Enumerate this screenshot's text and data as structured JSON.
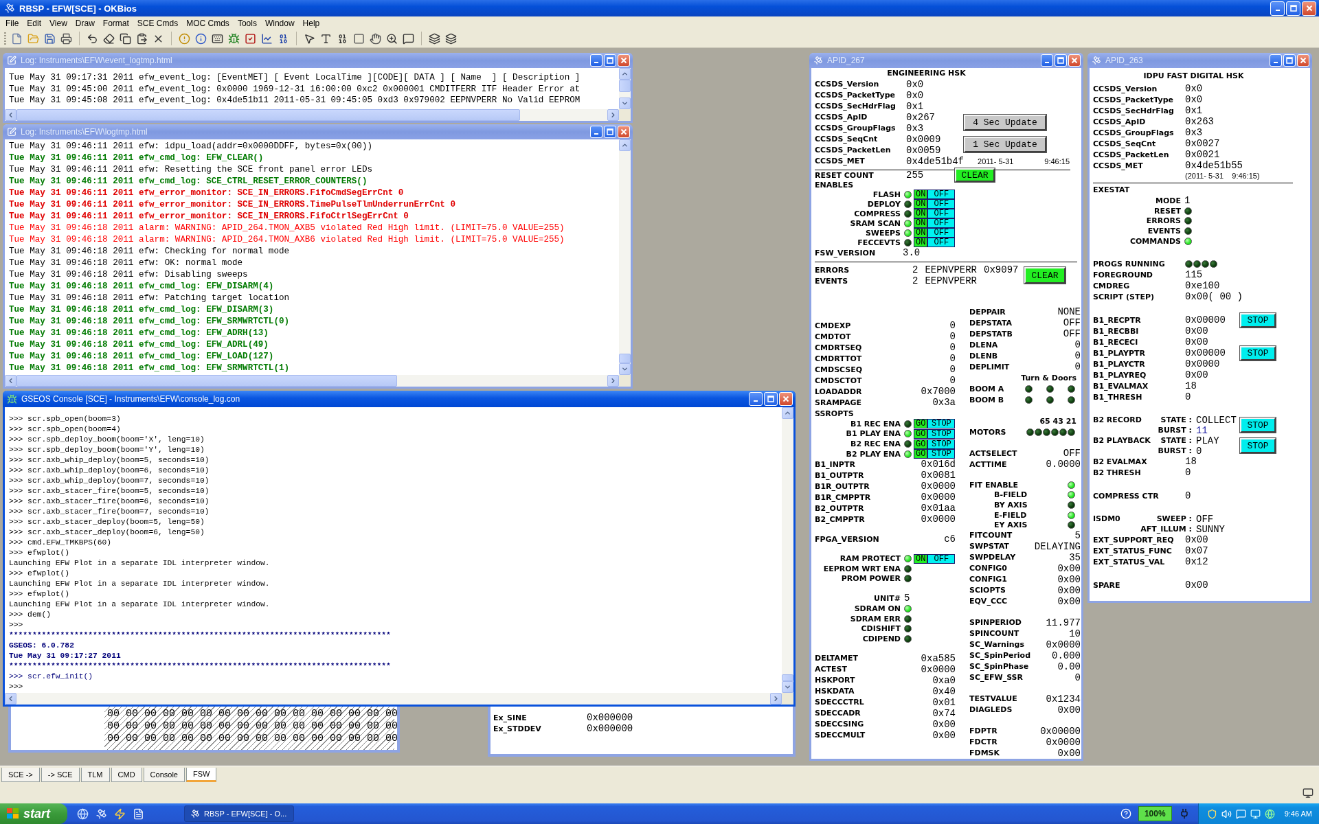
{
  "app": {
    "title": "RBSP - EFW[SCE] - OKBios"
  },
  "menu": [
    "File",
    "Edit",
    "View",
    "Draw",
    "Format",
    "SCE Cmds",
    "MOC Cmds",
    "Tools",
    "Window",
    "Help"
  ],
  "event_log": {
    "title": "Log: Instruments\\EFW\\event_logtmp.html",
    "lines": [
      "Tue May 31 09:17:31 2011 efw_event_log: [EventMET] [ Event LocalTime ][CODE][ DATA ] [ Name  ] [ Description ]",
      "Tue May 31 09:45:00 2011 efw_event_log: 0x0000 1969-12-31 16:00:00 0xc2 0x000001 CMDITFERR ITF Header Error at",
      "Tue May 31 09:45:08 2011 efw_event_log: 0x4de51b11 2011-05-31 09:45:05 0xd3 0x979002 EEPNVPERR No Valid EEPROM"
    ]
  },
  "log": {
    "title": "Log: Instruments\\EFW\\logtmp.html",
    "lines": [
      {
        "kind": "info",
        "text": "Tue May 31 09:46:11 2011 efw: idpu_load(addr=0x0000DDFF, bytes=0x(00))"
      },
      {
        "kind": "cmd",
        "text": "Tue May 31 09:46:11 2011 efw_cmd_log: EFW_CLEAR()"
      },
      {
        "kind": "info",
        "text": "Tue May 31 09:46:11 2011 efw: Resetting the SCE front panel error LEDs"
      },
      {
        "kind": "cmd",
        "text": "Tue May 31 09:46:11 2011 efw_cmd_log: SCE_CTRL_RESET_ERROR_COUNTERS()"
      },
      {
        "kind": "error",
        "text": "Tue May 31 09:46:11 2011 efw_error_monitor: SCE_IN_ERRORS.FifoCmdSegErrCnt 0"
      },
      {
        "kind": "error",
        "text": "Tue May 31 09:46:11 2011 efw_error_monitor: SCE_IN_ERRORS.TimePulseTlmUnderrunErrCnt 0"
      },
      {
        "kind": "error",
        "text": "Tue May 31 09:46:11 2011 efw_error_monitor: SCE_IN_ERRORS.FifoCtrlSegErrCnt 0"
      },
      {
        "kind": "alarm",
        "text": "Tue May 31 09:46:18 2011 alarm: WARNING: APID_264.TMON_AXB5 violated Red High limit. (LIMIT=75.0 VALUE=255)"
      },
      {
        "kind": "alarm",
        "text": "Tue May 31 09:46:18 2011 alarm: WARNING: APID_264.TMON_AXB6 violated Red High limit. (LIMIT=75.0 VALUE=255)"
      },
      {
        "kind": "info",
        "text": "Tue May 31 09:46:18 2011 efw: Checking for normal mode"
      },
      {
        "kind": "info",
        "text": "Tue May 31 09:46:18 2011 efw: OK: normal mode"
      },
      {
        "kind": "info",
        "text": "Tue May 31 09:46:18 2011 efw: Disabling sweeps"
      },
      {
        "kind": "cmd",
        "text": "Tue May 31 09:46:18 2011 efw_cmd_log: EFW_DISARM(4)"
      },
      {
        "kind": "info",
        "text": "Tue May 31 09:46:18 2011 efw: Patching target location"
      },
      {
        "kind": "cmd",
        "text": "Tue May 31 09:46:18 2011 efw_cmd_log: EFW_DISARM(3)"
      },
      {
        "kind": "cmd",
        "text": "Tue May 31 09:46:18 2011 efw_cmd_log: EFW_SRMWRTCTL(0)"
      },
      {
        "kind": "cmd",
        "text": "Tue May 31 09:46:18 2011 efw_cmd_log: EFW_ADRH(13)"
      },
      {
        "kind": "cmd",
        "text": "Tue May 31 09:46:18 2011 efw_cmd_log: EFW_ADRL(49)"
      },
      {
        "kind": "cmd",
        "text": "Tue May 31 09:46:18 2011 efw_cmd_log: EFW_LOAD(127)"
      },
      {
        "kind": "cmd",
        "text": "Tue May 31 09:46:18 2011 efw_cmd_log: EFW_SRMWRTCTL(1)"
      }
    ]
  },
  "console": {
    "title": "GSEOS Console  [SCE] - Instruments\\EFW\\console_log.con",
    "lines": [
      {
        "kind": "plain",
        "text": ">>> scr.spb_open(boom=3)"
      },
      {
        "kind": "plain",
        "text": ">>> scr.spb_open(boom=4)"
      },
      {
        "kind": "plain",
        "text": ">>> scr.spb_deploy_boom(boom='X', leng=10)"
      },
      {
        "kind": "plain",
        "text": ">>> scr.spb_deploy_boom(boom='Y', leng=10)"
      },
      {
        "kind": "plain",
        "text": ">>> scr.axb_whip_deploy(boom=5, seconds=10)"
      },
      {
        "kind": "plain",
        "text": ">>> scr.axb_whip_deploy(boom=6, seconds=10)"
      },
      {
        "kind": "plain",
        "text": ">>> scr.axb_whip_deploy(boom=7, seconds=10)"
      },
      {
        "kind": "plain",
        "text": ">>> scr.axb_stacer_fire(boom=5, seconds=10)"
      },
      {
        "kind": "plain",
        "text": ">>> scr.axb_stacer_fire(boom=6, seconds=10)"
      },
      {
        "kind": "plain",
        "text": ">>> scr.axb_stacer_fire(boom=7, seconds=10)"
      },
      {
        "kind": "plain",
        "text": ">>> scr.axb_stacer_deploy(boom=5, leng=50)"
      },
      {
        "kind": "plain",
        "text": ">>> scr.axb_stacer_deploy(boom=6, leng=50)"
      },
      {
        "kind": "plain",
        "text": ">>> cmd.EFW_TMKBPS(60)"
      },
      {
        "kind": "plain",
        "text": ">>> efwplot()"
      },
      {
        "kind": "plain",
        "text": "Launching EFW Plot in a separate IDL interpreter window."
      },
      {
        "kind": "plain",
        "text": ">>> efwplot()"
      },
      {
        "kind": "plain",
        "text": "Launching EFW Plot in a separate IDL interpreter window."
      },
      {
        "kind": "plain",
        "text": ">>> efwplot()"
      },
      {
        "kind": "plain",
        "text": "Launching EFW Plot in a separate IDL interpreter window."
      },
      {
        "kind": "plain",
        "text": ">>> dem()"
      },
      {
        "kind": "plain",
        "text": ">>>"
      },
      {
        "kind": "banner",
        "text": "**********************************************************************************"
      },
      {
        "kind": "banner",
        "text": "GSEOS: 6.0.782"
      },
      {
        "kind": "banner",
        "text": "Tue May 31 09:17:27 2011"
      },
      {
        "kind": "banner",
        "text": "**********************************************************************************"
      },
      {
        "kind": "echo",
        "text": ">>> scr.efw_init()"
      },
      {
        "kind": "plain",
        "text": ">>>"
      }
    ]
  },
  "hex_window": {
    "rows": [
      "00 00 00 00 00 00 00 00 00 00 00 00 00 00 00 00",
      "00 00 00 00 00 00 00 00 00 00 00 00 00 00 00 00",
      "00 00 00 00 00 00 00 00 00 00 00 00 00 00 00 00"
    ]
  },
  "ex_window": {
    "rows": [
      {
        "label": "Ex_SINE",
        "value": "0x000000"
      },
      {
        "label": "Ex_STDDEV",
        "value": "0x000000"
      }
    ]
  },
  "apid_267": {
    "title": "APID_267",
    "heading": "ENGINEERING HSK",
    "header": [
      {
        "label": "CCSDS_Version",
        "value": "0x0"
      },
      {
        "label": "CCSDS_PacketType",
        "value": "0x0"
      },
      {
        "label": "CCSDS_SecHdrFlag",
        "value": "0x1"
      },
      {
        "label": "CCSDS_ApID",
        "value": "0x267",
        "button": "4 Sec Update"
      },
      {
        "label": "CCSDS_GroupFlags",
        "value": "0x3"
      },
      {
        "label": "CCSDS_SeqCnt",
        "value": "0x0009",
        "button": "1 Sec Update"
      },
      {
        "label": "CCSDS_PacketLen",
        "value": "0x0059"
      },
      {
        "label": "CCSDS_MET",
        "value": "0x4de51b4f",
        "extra": [
          "2011- 5-31",
          "9:46:15"
        ]
      }
    ],
    "reset": {
      "label": "RESET COUNT",
      "value": "255",
      "button": "CLEAR"
    },
    "enables": {
      "label": "ENABLES",
      "rows": [
        {
          "kind": "led",
          "label": "FLASH",
          "lit": true,
          "toggle": {
            "on": "ON",
            "off": "OFF"
          }
        },
        {
          "kind": "led",
          "label": "DEPLOY",
          "lit": false,
          "toggle": {
            "on": "ON",
            "off": "OFF"
          }
        },
        {
          "kind": "led",
          "label": "COMPRESS",
          "lit": false,
          "toggle": {
            "on": "ON",
            "off": "OFF"
          }
        },
        {
          "kind": "led",
          "label": "SRAM SCAN",
          "lit": true,
          "toggle": {
            "on": "ON",
            "off": "OFF"
          }
        },
        {
          "kind": "led",
          "label": "SWEEPS",
          "lit": true,
          "toggle": {
            "on": "ON",
            "off": "OFF"
          }
        },
        {
          "kind": "led",
          "label": "FECCEVTS",
          "lit": false,
          "toggle": {
            "on": "ON",
            "off": "OFF"
          }
        }
      ]
    },
    "fsw_version": {
      "label": "FSW_VERSION",
      "value": "3.0"
    },
    "counters": {
      "rows": [
        {
          "label": "ERRORS",
          "values": [
            "2",
            "EEPNVPERR",
            "0x9097"
          ]
        },
        {
          "label": "EVENTS",
          "values": [
            "2",
            "EEPNVPERR"
          ]
        }
      ],
      "button": "CLEAR"
    },
    "columns": [
      [
        [
          {
            "kind": "value",
            "label": "CMDEXP",
            "value": "0"
          },
          {
            "kind": "value",
            "label": "CMDTOT",
            "value": "0"
          },
          {
            "kind": "value",
            "label": "CMDRTSEQ",
            "value": "0"
          },
          {
            "kind": "value",
            "label": "CMDRTTOT",
            "value": "0"
          },
          {
            "kind": "value",
            "label": "CMDSCSEQ",
            "value": "0"
          },
          {
            "kind": "value",
            "label": "CMDSCTOT",
            "value": "0"
          },
          {
            "kind": "value",
            "label": "LOADADDR",
            "value": "0x7000"
          },
          {
            "kind": "value",
            "label": "SRAMPAGE",
            "value": "0x3a"
          },
          {
            "kind": "heading",
            "text": "SSROPTS",
            "children": [
              {
                "kind": "led",
                "label": "B1 REC ENA",
                "lit": false,
                "toggle": {
                  "on": "GO",
                  "off": "STOP"
                }
              },
              {
                "kind": "led",
                "label": "B1 PLAY ENA",
                "lit": true,
                "toggle": {
                  "on": "GO",
                  "off": "STOP"
                }
              },
              {
                "kind": "led",
                "label": "B2 REC ENA",
                "lit": false,
                "toggle": {
                  "on": "GO",
                  "off": "STOP"
                }
              },
              {
                "kind": "led",
                "label": "B2 PLAY ENA",
                "lit": true,
                "toggle": {
                  "on": "GO",
                  "off": "STOP"
                }
              }
            ]
          },
          {
            "kind": "value",
            "label": "B1_INPTR",
            "value": "0x016d"
          },
          {
            "kind": "value",
            "label": "B1_OUTPTR",
            "value": "0x0081"
          },
          {
            "kind": "value",
            "label": "B1R_OUTPTR",
            "value": "0x0000"
          },
          {
            "kind": "value",
            "label": "B1R_CMPPTR",
            "value": "0x0000"
          },
          {
            "kind": "value",
            "label": "B2_OUTPTR",
            "value": "0x01aa"
          },
          {
            "kind": "value",
            "label": "B2_CMPPTR",
            "value": "0x0000"
          }
        ],
        [
          {
            "kind": "value",
            "label": "FPGA_VERSION",
            "value": "c6"
          }
        ],
        [
          {
            "kind": "led",
            "label": "RAM PROTECT",
            "lit": true,
            "toggle": {
              "on": "ON",
              "off": "OFF"
            }
          },
          {
            "kind": "led",
            "label": "EEPROM WRT ENA",
            "lit": false
          },
          {
            "kind": "led",
            "label": "PROM POWER",
            "lit": false
          }
        ],
        [
          {
            "kind": "value",
            "label": "UNIT#",
            "value": "5"
          },
          {
            "kind": "led",
            "label": "SDRAM ON",
            "lit": true
          },
          {
            "kind": "led",
            "label": "SDRAM ERR",
            "lit": false
          },
          {
            "kind": "led",
            "label": "CDISHIFT",
            "lit": false
          },
          {
            "kind": "led",
            "label": "CDIPEND",
            "lit": false
          }
        ],
        [
          {
            "kind": "value",
            "label": "DELTAMET",
            "value": "0xa585"
          },
          {
            "kind": "value",
            "label": "ACTEST",
            "value": "0x0000"
          },
          {
            "kind": "value",
            "label": "HSKPORT",
            "value": "0xa0"
          },
          {
            "kind": "value",
            "label": "HSKDATA",
            "value": "0x40"
          },
          {
            "kind": "value",
            "label": "SDECCCTRL",
            "value": "0x01"
          },
          {
            "kind": "value",
            "label": "SDECCADR",
            "value": "0x74"
          },
          {
            "kind": "value",
            "label": "SDECCSING",
            "value": "0x00"
          },
          {
            "kind": "value",
            "label": "SDECCMULT",
            "value": "0x00"
          }
        ]
      ],
      [
        [
          {
            "kind": "value",
            "label": "DEPPAIR",
            "value": "NONE"
          },
          {
            "kind": "value",
            "label": "DEPSTATA",
            "value": "OFF"
          },
          {
            "kind": "value",
            "label": "DEPSTATB",
            "value": "OFF"
          },
          {
            "kind": "value",
            "label": "DLENA",
            "value": "0"
          },
          {
            "kind": "value",
            "label": "DLENB",
            "value": "0"
          },
          {
            "kind": "value",
            "label": "DEPLIMIT",
            "value": "0"
          },
          {
            "kind": "heading",
            "text": "Turn & Doors"
          },
          {
            "kind": "leds",
            "label": "BOOM A",
            "leds": [
              false,
              false,
              false
            ]
          },
          {
            "kind": "leds",
            "label": "BOOM B",
            "leds": [
              false,
              false,
              false
            ]
          }
        ],
        [
          {
            "kind": "heading",
            "text": "65 43 21"
          },
          {
            "kind": "leds",
            "label": "MOTORS",
            "leds": [
              false,
              false,
              false,
              false,
              false,
              false
            ]
          }
        ],
        [
          {
            "kind": "value",
            "label": "ACTSELECT",
            "value": "OFF"
          },
          {
            "kind": "value",
            "label": "ACTTIME",
            "value": "0.0000"
          }
        ],
        [
          {
            "kind": "led",
            "label": "FIT ENABLE",
            "lit": true,
            "children": [
              {
                "kind": "led",
                "label": "B-FIELD",
                "lit": true
              },
              {
                "kind": "led",
                "label": "BY AXIS",
                "lit": false
              },
              {
                "kind": "led",
                "label": "E-FIELD",
                "lit": true
              },
              {
                "kind": "led",
                "label": "EY AXIS",
                "lit": false
              }
            ]
          },
          {
            "kind": "value",
            "label": "FITCOUNT",
            "value": "5"
          },
          {
            "kind": "value",
            "label": "SWPSTAT",
            "value": "DELAYING"
          },
          {
            "kind": "value",
            "label": "SWPDELAY",
            "value": "35"
          },
          {
            "kind": "value",
            "label": "CONFIG0",
            "value": "0x00"
          },
          {
            "kind": "value",
            "label": "CONFIG1",
            "value": "0x00"
          },
          {
            "kind": "value",
            "label": "SCIOPTS",
            "value": "0x00"
          },
          {
            "kind": "value",
            "label": "EQV_CCC",
            "value": "0x00"
          }
        ],
        [
          {
            "kind": "value",
            "label": "SPINPERIOD",
            "value": "11.977"
          },
          {
            "kind": "value",
            "label": "SPINCOUNT",
            "value": "10"
          },
          {
            "kind": "value",
            "label": "SC_Warnings",
            "value": "0x0000"
          },
          {
            "kind": "value",
            "label": "SC_SpinPeriod",
            "value": "0.000"
          },
          {
            "kind": "value",
            "label": "SC_SpinPhase",
            "value": "0.00"
          },
          {
            "kind": "value",
            "label": "SC_EFW_SSR",
            "value": "0"
          }
        ],
        [
          {
            "kind": "value",
            "label": "TESTVALUE",
            "value": "0x1234"
          },
          {
            "kind": "value",
            "label": "DIAGLEDS",
            "value": "0x00"
          }
        ],
        [
          {
            "kind": "value",
            "label": "FDPTR",
            "value": "0x00000"
          },
          {
            "kind": "value",
            "label": "FDCTR",
            "value": "0x0000"
          },
          {
            "kind": "value",
            "label": "FDMSK",
            "value": "0x00"
          }
        ]
      ]
    ]
  },
  "apid_263": {
    "title": "APID_263",
    "heading": "IDPU FAST DIGITAL HSK",
    "header": [
      {
        "label": "CCSDS_Version",
        "value": "0x0"
      },
      {
        "label": "CCSDS_PacketType",
        "value": "0x0"
      },
      {
        "label": "CCSDS_SecHdrFlag",
        "value": "0x1"
      },
      {
        "label": "CCSDS_ApID",
        "value": "0x263"
      },
      {
        "label": "CCSDS_GroupFlags",
        "value": "0x3"
      },
      {
        "label": "CCSDS_SeqCnt",
        "value": "0x0027"
      },
      {
        "label": "CCSDS_PacketLen",
        "value": "0x0021"
      },
      {
        "label": "CCSDS_MET",
        "value": "0x4de51b55",
        "note": "(2011- 5-31    9:46:15)"
      }
    ],
    "groups": [
      [
        {
          "kind": "heading",
          "text": "EXESTAT",
          "children": [
            {
              "kind": "value",
              "label": "MODE",
              "value": "1"
            },
            {
              "kind": "led",
              "label": "RESET",
              "lit": false
            },
            {
              "kind": "led",
              "label": "ERRORS",
              "lit": false
            },
            {
              "kind": "led",
              "label": "EVENTS",
              "lit": false
            },
            {
              "kind": "led",
              "label": "COMMANDS",
              "lit": true
            }
          ]
        }
      ],
      [
        {
          "kind": "leds",
          "label": "PROGS RUNNING",
          "leds": [
            false,
            false,
            false,
            false
          ]
        },
        {
          "kind": "value",
          "label": "FOREGROUND",
          "value": "115"
        },
        {
          "kind": "value",
          "label": "CMDREG",
          "value": "0xe100"
        },
        {
          "kind": "value",
          "label": "SCRIPT (STEP)",
          "value": "0x00( 00 )"
        }
      ],
      [
        {
          "kind": "value",
          "label": "B1_RECPTR",
          "value": "0x00000",
          "button": "STOP"
        },
        {
          "kind": "value",
          "label": "B1_RECBBI",
          "value": "0x00"
        },
        {
          "kind": "value",
          "label": "B1_RECECI",
          "value": "0x00"
        },
        {
          "kind": "value",
          "label": "B1_PLAYPTR",
          "value": "0x00000",
          "button": "STOP"
        },
        {
          "kind": "value",
          "label": "B1_PLAYCTR",
          "value": "0x0000"
        },
        {
          "kind": "value",
          "label": "B1_PLAYREQ",
          "value": "0x00"
        },
        {
          "kind": "value",
          "label": "B1_EVALMAX",
          "value": "18"
        },
        {
          "kind": "value",
          "label": "B1_THRESH",
          "value": "0"
        }
      ],
      [
        {
          "kind": "state",
          "label": "B2 RECORD",
          "lines": [
            {
              "label": "STATE :",
              "value": "COLLECT"
            },
            {
              "label": "BURST :",
              "value": "11",
              "color": "#1a1aa0"
            }
          ],
          "button": "STOP"
        },
        {
          "kind": "state",
          "label": "B2 PLAYBACK",
          "lines": [
            {
              "label": "STATE :",
              "value": "PLAY"
            },
            {
              "label": "BURST :",
              "value": "0"
            }
          ],
          "button": "STOP"
        },
        {
          "kind": "value",
          "label": "B2 EVALMAX",
          "value": "18"
        },
        {
          "kind": "value",
          "label": "B2 THRESH",
          "value": "0"
        }
      ],
      [
        {
          "kind": "value",
          "label": "COMPRESS CTR",
          "value": "0"
        }
      ],
      [
        {
          "kind": "state",
          "label": "ISDM0",
          "lines": [
            {
              "label": "SWEEP :",
              "value": "OFF"
            },
            {
              "label": "AFT_ILLUM :",
              "value": "SUNNY"
            }
          ]
        },
        {
          "kind": "value",
          "label": "EXT_SUPPORT_REQ",
          "value": "0x00"
        },
        {
          "kind": "value",
          "label": "EXT_STATUS_FUNC",
          "value": "0x07"
        },
        {
          "kind": "value",
          "label": "EXT_STATUS_VAL",
          "value": "0x12"
        }
      ],
      [
        {
          "kind": "value",
          "label": "SPARE",
          "value": "0x00"
        }
      ]
    ]
  },
  "tabs": [
    {
      "label": "SCE ->",
      "selected": false
    },
    {
      "label": "-> SCE",
      "selected": false
    },
    {
      "label": "TLM",
      "selected": false
    },
    {
      "label": "CMD",
      "selected": false
    },
    {
      "label": "Console",
      "selected": false
    },
    {
      "label": "FSW",
      "selected": true
    }
  ],
  "taskbar": {
    "start": "start",
    "task": "RBSP - EFW[SCE] - O...",
    "battery": "100%",
    "clock": "9:46 AM"
  }
}
